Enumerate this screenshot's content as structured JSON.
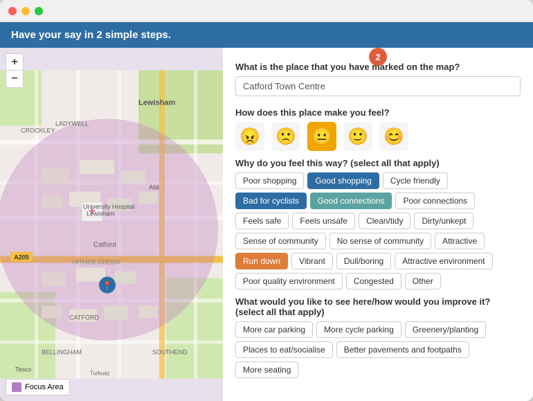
{
  "window": {
    "title": "Have your say in 2 simple steps."
  },
  "header": {
    "text": "Have your say in 2 simple steps."
  },
  "step_badge": "2",
  "form": {
    "question1": "What is the place that you have marked on the map?",
    "input_value": "Catford Town Centre",
    "question2": "How does this place make you feel?",
    "question3": "Why do you feel this way? (select all that apply)",
    "question4": "What would you like to see here/how would you improve it? (select all that apply)"
  },
  "emojis": [
    {
      "symbol": "😠",
      "selected": false,
      "label": "very unhappy"
    },
    {
      "symbol": "🙁",
      "selected": false,
      "label": "unhappy"
    },
    {
      "symbol": "😐",
      "selected": true,
      "label": "neutral"
    },
    {
      "symbol": "🙂",
      "selected": false,
      "label": "happy"
    },
    {
      "symbol": "😊",
      "selected": false,
      "label": "very happy"
    }
  ],
  "why_tags": [
    {
      "label": "Poor shopping",
      "state": "none"
    },
    {
      "label": "Good shopping",
      "state": "blue"
    },
    {
      "label": "Cycle friendly",
      "state": "none"
    },
    {
      "label": "Bad for cyclists",
      "state": "blue"
    },
    {
      "label": "Good connections",
      "state": "teal"
    },
    {
      "label": "Poor connections",
      "state": "none"
    },
    {
      "label": "Feels safe",
      "state": "none"
    },
    {
      "label": "Feels unsafe",
      "state": "none"
    },
    {
      "label": "Clean/tidy",
      "state": "none"
    },
    {
      "label": "Dirty/unkept",
      "state": "none"
    },
    {
      "label": "Sense of community",
      "state": "none"
    },
    {
      "label": "No sense of community",
      "state": "none"
    },
    {
      "label": "Attractive",
      "state": "none"
    },
    {
      "label": "Run down",
      "state": "orange"
    },
    {
      "label": "Vibrant",
      "state": "none"
    },
    {
      "label": "Dull/boring",
      "state": "none"
    },
    {
      "label": "Attractive environment",
      "state": "none"
    },
    {
      "label": "Poor quality environment",
      "state": "none"
    },
    {
      "label": "Congested",
      "state": "none"
    },
    {
      "label": "Other",
      "state": "none"
    }
  ],
  "improve_tags": [
    {
      "label": "More car parking",
      "state": "none"
    },
    {
      "label": "More cycle parking",
      "state": "none"
    },
    {
      "label": "Greenery/planting",
      "state": "none"
    },
    {
      "label": "Places to eat/socialise",
      "state": "none"
    },
    {
      "label": "Better pavements and footpaths",
      "state": "none"
    },
    {
      "label": "More seating",
      "state": "none"
    }
  ],
  "map_controls": {
    "zoom_in": "+",
    "zoom_out": "−"
  },
  "legend": {
    "label": "Focus Area",
    "color": "#b07ec0"
  }
}
